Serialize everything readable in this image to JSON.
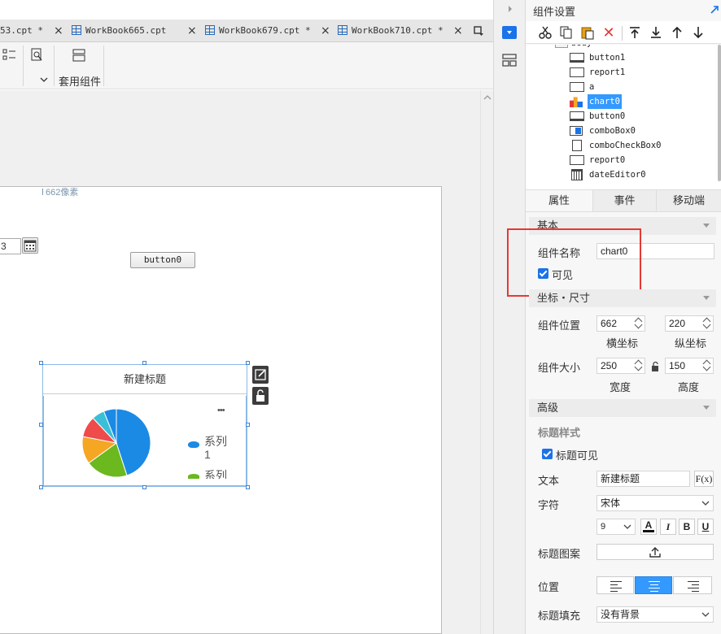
{
  "tabs": [
    {
      "label": "53.cpt *"
    },
    {
      "label": "WorkBook665.cpt"
    },
    {
      "label": "WorkBook679.cpt *"
    },
    {
      "label": "WorkBook710.cpt *"
    }
  ],
  "toolbar": {
    "apply_component_label": "套用组件"
  },
  "canvas": {
    "pixel_hint": "662像素",
    "date_value": "3",
    "button0_label": "button0",
    "chart_title": "新建标题",
    "more_glyph": "•••",
    "legend_1": "系列",
    "legend_1_num": "1",
    "legend_2": "系列"
  },
  "chart_data": {
    "type": "pie",
    "categories": [
      "",
      "",
      "",
      "",
      "",
      ""
    ],
    "values": [
      45,
      20,
      13,
      10,
      6,
      6
    ],
    "colors": [
      "#1a8ae5",
      "#6cb81f",
      "#f5a623",
      "#f04b4b",
      "#3bbfd6",
      "#1a8ae5"
    ]
  },
  "panel": {
    "title": "组件设置",
    "tree": [
      "button1",
      "report1",
      "a",
      "chart0",
      "button0",
      "comboBox0",
      "comboCheckBox0",
      "report0",
      "dateEditor0"
    ],
    "tree_selected": "chart0",
    "tabs": [
      "属性",
      "事件",
      "移动端"
    ],
    "basic_section": "基本",
    "name_label": "组件名称",
    "name_value": "chart0",
    "visible_label": "可见",
    "coord_section": "坐标・尺寸",
    "pos_label": "组件位置",
    "x_value": "662",
    "y_value": "220",
    "x_caption": "横坐标",
    "y_caption": "纵坐标",
    "size_label": "组件大小",
    "w_value": "250",
    "h_value": "150",
    "w_caption": "宽度",
    "h_caption": "高度",
    "advanced_section": "高级",
    "title_style": "标题样式",
    "title_visible_label": "标题可见",
    "text_label": "文本",
    "text_value": "新建标题",
    "formula_btn": "F(x)",
    "font_label": "字符",
    "font_value": "宋体",
    "size_value": "9",
    "fmt_a": "A",
    "fmt_i": "I",
    "fmt_b": "B",
    "fmt_u": "U",
    "title_pattern_label": "标题图案",
    "position_label": "位置",
    "fill_label": "标题填充",
    "fill_value": "没有背景"
  },
  "colors": {
    "accent": "#1a73e8",
    "highlight_box": "#e53935",
    "selected": "#3399ff"
  }
}
